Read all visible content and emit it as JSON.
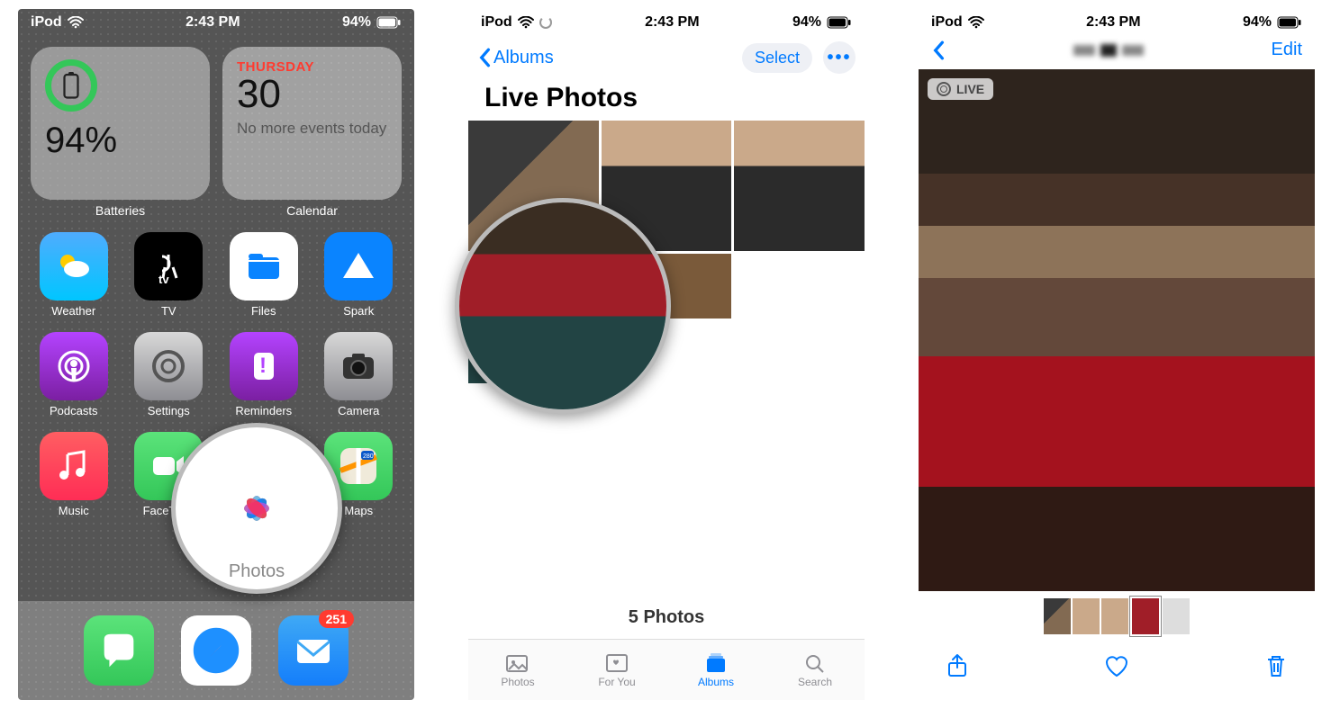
{
  "status": {
    "device": "iPod",
    "time": "2:43 PM",
    "battery_pct": "94%"
  },
  "s1": {
    "batteries_widget": {
      "pct": "94%",
      "label": "Batteries"
    },
    "calendar_widget": {
      "day": "THURSDAY",
      "date": "30",
      "text": "No more events today",
      "label": "Calendar"
    },
    "apps": {
      "weather": "Weather",
      "tv": "TV",
      "files": "Files",
      "spark": "Spark",
      "podcasts": "Podcasts",
      "settings": "Settings",
      "reminders": "Reminders",
      "camera": "Camera",
      "music": "Music",
      "facetime": "FaceTime",
      "photos": "Photos",
      "maps": "Maps"
    },
    "mail_badge": "251",
    "mag_label": "Photos"
  },
  "s2": {
    "back": "Albums",
    "select": "Select",
    "title": "Live Photos",
    "count": "5 Photos",
    "tabs": {
      "photos": "Photos",
      "foryou": "For You",
      "albums": "Albums",
      "search": "Search"
    }
  },
  "s3": {
    "edit": "Edit",
    "live_badge": "LIVE"
  }
}
